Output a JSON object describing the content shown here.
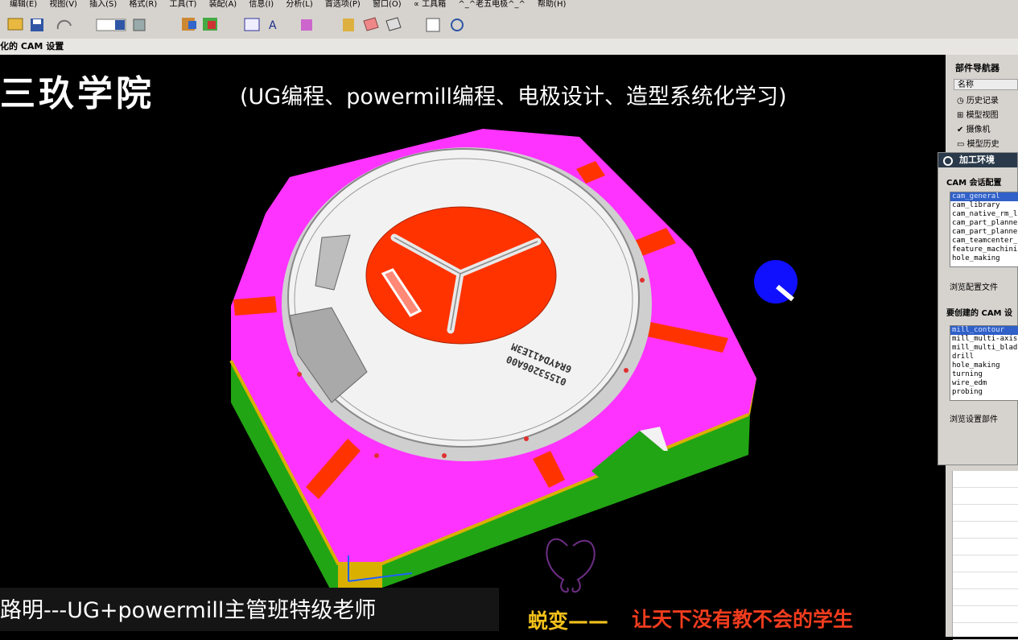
{
  "menu": [
    "编辑(E)",
    "视图(V)",
    "插入(S)",
    "格式(R)",
    "工具(T)",
    "装配(A)",
    "信息(I)",
    "分析(L)",
    "首选项(P)",
    "窗口(O)",
    "∝ 工具箱",
    "^_^老五电极^_^",
    "帮助(H)"
  ],
  "cam_bar": "化的 CAM 设置",
  "overlay": {
    "title": "三玖学院",
    "subtitle": "(UG编程、powermill编程、电极设计、造型系统化学习)",
    "bottom_left": "路明---UG+powermill主管班特级老师",
    "slogan_a": "蜕变——",
    "slogan_b": "让天下没有教不会的学生"
  },
  "part_text": {
    "line1": "01553206A00",
    "line2": "6R4YD411E3M"
  },
  "navigator": {
    "title": "部件导航器",
    "header": "名称",
    "items": [
      "历史记录",
      "模型视图",
      "摄像机",
      "模型历史"
    ]
  },
  "dialog": {
    "title": "加工环境",
    "session_label": "CAM 会话配置",
    "session_items": [
      "cam_general",
      "cam_library",
      "cam_native_rm_l",
      "cam_part_planne",
      "cam_part_planne",
      "cam_teamcenter_",
      "feature_machini",
      "hole_making"
    ],
    "session_selected": 0,
    "browse_config": "浏览配置文件",
    "setup_label": "要创建的 CAM 设",
    "setup_items": [
      "mill_contour",
      "mill_multi-axis",
      "mill_multi_blad",
      "drill",
      "hole_making",
      "turning",
      "wire_edm",
      "probing"
    ],
    "setup_selected": 0,
    "browse_setup": "浏览设置部件"
  },
  "colors": {
    "magenta": "#ff33ff",
    "red": "#ff3300",
    "yellow": "#d9b000",
    "green": "#22a514",
    "white_top": "#f2f2f2",
    "blue_ball": "#1010ff"
  }
}
